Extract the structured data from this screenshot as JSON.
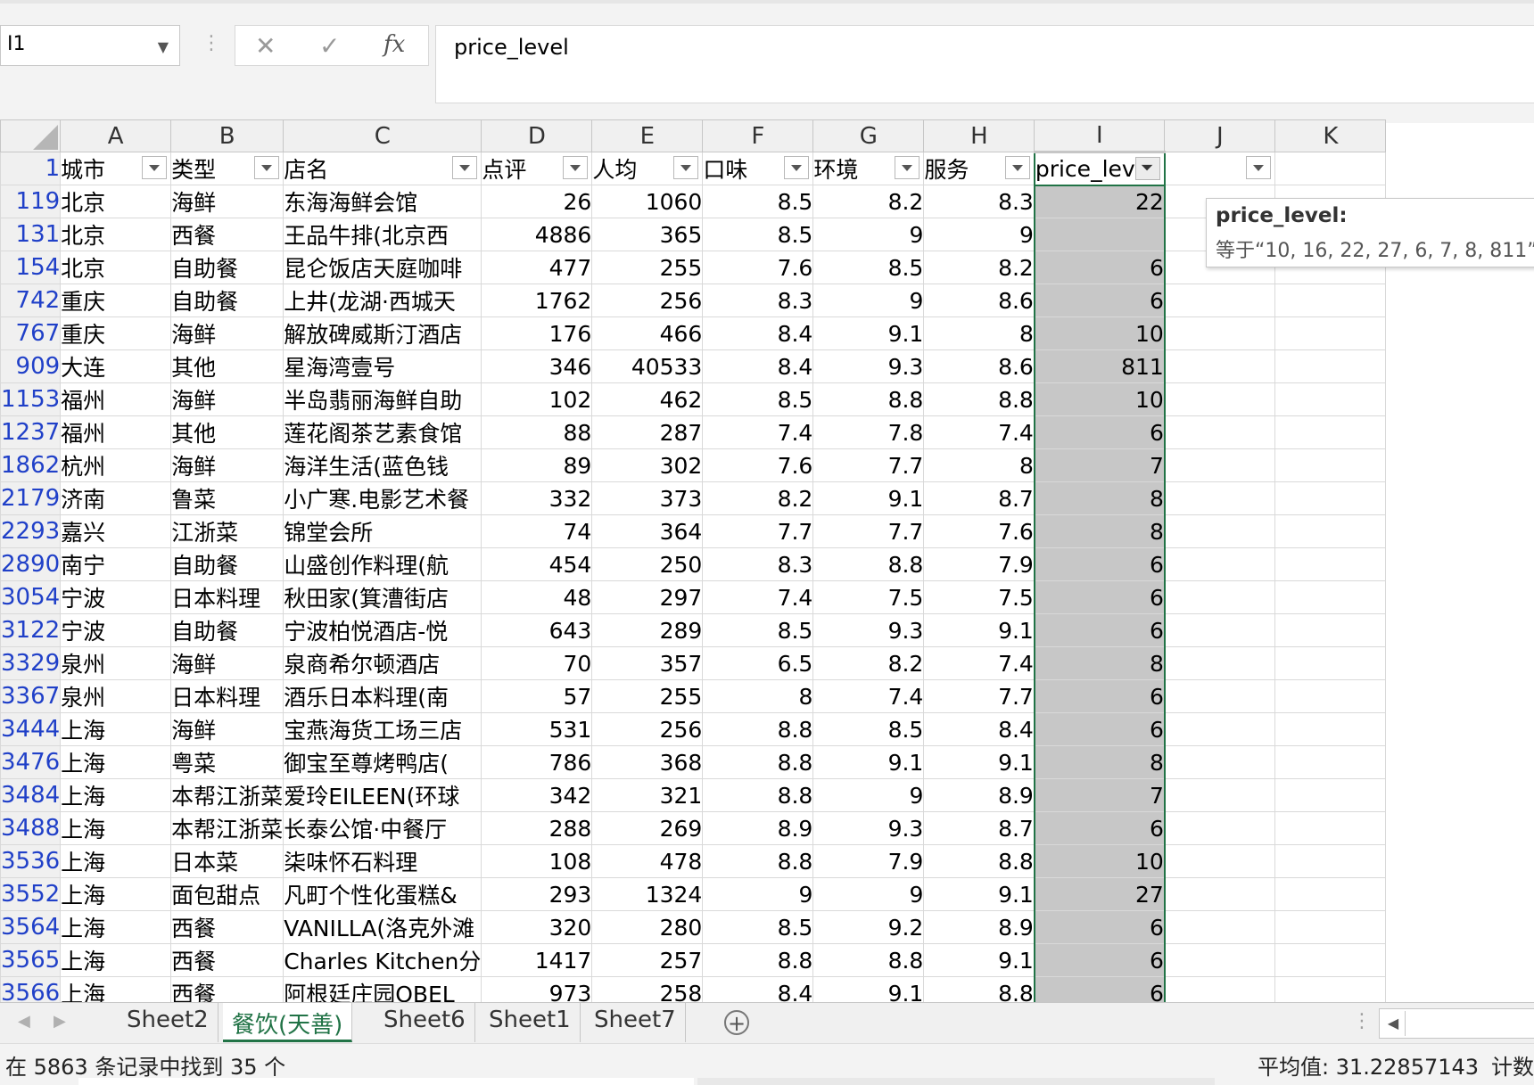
{
  "formula_bar": {
    "name_box": "I1",
    "cancel_icon": "✕",
    "enter_icon": "✓",
    "fx_label": "fx",
    "content": "price_level"
  },
  "columns": [
    "A",
    "B",
    "C",
    "D",
    "E",
    "F",
    "G",
    "H",
    "I",
    "J",
    "K"
  ],
  "selected_column": "I",
  "header_row": {
    "row_number": "1",
    "cells": [
      "城市",
      "类型",
      "店名",
      "点评",
      "人均",
      "口味",
      "环境",
      "服务",
      "price_leve",
      ""
    ]
  },
  "rows": [
    {
      "n": "119",
      "city": "北京",
      "type": "海鲜",
      "name": "东海海鲜会馆",
      "reviews": "26",
      "avg": "1060",
      "taste": "8.5",
      "env": "8.2",
      "service": "8.3",
      "price_level": "22"
    },
    {
      "n": "131",
      "city": "北京",
      "type": "西餐",
      "name": "王品牛排(北京西",
      "reviews": "4886",
      "avg": "365",
      "taste": "8.5",
      "env": "9",
      "service": "9",
      "price_level": ""
    },
    {
      "n": "154",
      "city": "北京",
      "type": "自助餐",
      "name": "昆仑饭店天庭咖啡",
      "reviews": "477",
      "avg": "255",
      "taste": "7.6",
      "env": "8.5",
      "service": "8.2",
      "price_level": "6"
    },
    {
      "n": "742",
      "city": "重庆",
      "type": "自助餐",
      "name": "上井(龙湖·西城天",
      "reviews": "1762",
      "avg": "256",
      "taste": "8.3",
      "env": "9",
      "service": "8.6",
      "price_level": "6"
    },
    {
      "n": "767",
      "city": "重庆",
      "type": "海鲜",
      "name": "解放碑威斯汀酒店",
      "reviews": "176",
      "avg": "466",
      "taste": "8.4",
      "env": "9.1",
      "service": "8",
      "price_level": "10"
    },
    {
      "n": "909",
      "city": "大连",
      "type": "其他",
      "name": "星海湾壹号",
      "reviews": "346",
      "avg": "40533",
      "taste": "8.4",
      "env": "9.3",
      "service": "8.6",
      "price_level": "811"
    },
    {
      "n": "1153",
      "city": "福州",
      "type": "海鲜",
      "name": "半岛翡丽海鲜自助",
      "reviews": "102",
      "avg": "462",
      "taste": "8.5",
      "env": "8.8",
      "service": "8.8",
      "price_level": "10"
    },
    {
      "n": "1237",
      "city": "福州",
      "type": "其他",
      "name": "莲花阁茶艺素食馆",
      "reviews": "88",
      "avg": "287",
      "taste": "7.4",
      "env": "7.8",
      "service": "7.4",
      "price_level": "6"
    },
    {
      "n": "1862",
      "city": "杭州",
      "type": "海鲜",
      "name": "海洋生活(蓝色钱",
      "reviews": "89",
      "avg": "302",
      "taste": "7.6",
      "env": "7.7",
      "service": "8",
      "price_level": "7"
    },
    {
      "n": "2179",
      "city": "济南",
      "type": "鲁菜",
      "name": "小广寒.电影艺术餐",
      "reviews": "332",
      "avg": "373",
      "taste": "8.2",
      "env": "9.1",
      "service": "8.7",
      "price_level": "8"
    },
    {
      "n": "2293",
      "city": "嘉兴",
      "type": "江浙菜",
      "name": "锦堂会所",
      "reviews": "74",
      "avg": "364",
      "taste": "7.7",
      "env": "7.7",
      "service": "7.6",
      "price_level": "8"
    },
    {
      "n": "2890",
      "city": "南宁",
      "type": "自助餐",
      "name": "山盛创作料理(航",
      "reviews": "454",
      "avg": "250",
      "taste": "8.3",
      "env": "8.8",
      "service": "7.9",
      "price_level": "6"
    },
    {
      "n": "3054",
      "city": "宁波",
      "type": "日本料理",
      "name": "秋田家(箕漕街店",
      "reviews": "48",
      "avg": "297",
      "taste": "7.4",
      "env": "7.5",
      "service": "7.5",
      "price_level": "6"
    },
    {
      "n": "3122",
      "city": "宁波",
      "type": "自助餐",
      "name": "宁波柏悦酒店-悦",
      "reviews": "643",
      "avg": "289",
      "taste": "8.5",
      "env": "9.3",
      "service": "9.1",
      "price_level": "6"
    },
    {
      "n": "3329",
      "city": "泉州",
      "type": "海鲜",
      "name": "泉商希尔顿酒店",
      "reviews": "70",
      "avg": "357",
      "taste": "6.5",
      "env": "8.2",
      "service": "7.4",
      "price_level": "8"
    },
    {
      "n": "3367",
      "city": "泉州",
      "type": "日本料理",
      "name": "酒乐日本料理(南",
      "reviews": "57",
      "avg": "255",
      "taste": "8",
      "env": "7.4",
      "service": "7.7",
      "price_level": "6"
    },
    {
      "n": "3444",
      "city": "上海",
      "type": "海鲜",
      "name": "宝燕海货工场三店",
      "reviews": "531",
      "avg": "256",
      "taste": "8.8",
      "env": "8.5",
      "service": "8.4",
      "price_level": "6"
    },
    {
      "n": "3476",
      "city": "上海",
      "type": "粤菜",
      "name": "御宝至尊烤鸭店(",
      "reviews": "786",
      "avg": "368",
      "taste": "8.8",
      "env": "9.1",
      "service": "9.1",
      "price_level": "8"
    },
    {
      "n": "3484",
      "city": "上海",
      "type": "本帮江浙菜",
      "name": "爱玲EILEEN(环球",
      "reviews": "342",
      "avg": "321",
      "taste": "8.8",
      "env": "9",
      "service": "8.9",
      "price_level": "7"
    },
    {
      "n": "3488",
      "city": "上海",
      "type": "本帮江浙菜",
      "name": "长泰公馆·中餐厅",
      "reviews": "288",
      "avg": "269",
      "taste": "8.9",
      "env": "9.3",
      "service": "8.7",
      "price_level": "6"
    },
    {
      "n": "3536",
      "city": "上海",
      "type": "日本菜",
      "name": "柒味怀石料理",
      "reviews": "108",
      "avg": "478",
      "taste": "8.8",
      "env": "7.9",
      "service": "8.8",
      "price_level": "10"
    },
    {
      "n": "3552",
      "city": "上海",
      "type": "面包甜点",
      "name": "凡町个性化蛋糕&",
      "reviews": "293",
      "avg": "1324",
      "taste": "9",
      "env": "9",
      "service": "9.1",
      "price_level": "27"
    },
    {
      "n": "3564",
      "city": "上海",
      "type": "西餐",
      "name": "VANILLA(洛克外滩",
      "reviews": "320",
      "avg": "280",
      "taste": "8.5",
      "env": "9.2",
      "service": "8.9",
      "price_level": "6"
    },
    {
      "n": "3565",
      "city": "上海",
      "type": "西餐",
      "name": "Charles Kitchen分",
      "reviews": "1417",
      "avg": "257",
      "taste": "8.8",
      "env": "8.8",
      "service": "9.1",
      "price_level": "6"
    },
    {
      "n": "3566",
      "city": "上海",
      "type": "西餐",
      "name": "阿根廷庄园OBEL",
      "reviews": "973",
      "avg": "258",
      "taste": "8.4",
      "env": "9.1",
      "service": "8.8",
      "price_level": "6"
    }
  ],
  "tooltip": {
    "title": "price_level:",
    "body": "等于“10, 16, 22, 27, 6, 7, 8, 811”"
  },
  "sheet_tabs": [
    {
      "label": "Sheet2",
      "active": false
    },
    {
      "label": "餐饮(天善)",
      "active": true
    },
    {
      "label": "Sheet6",
      "active": false
    },
    {
      "label": "Sheet1",
      "active": false
    },
    {
      "label": "Sheet7",
      "active": false
    }
  ],
  "status_bar": {
    "filter_message": "在 5863 条记录中找到 35 个",
    "average": "平均值: 31.22857143",
    "count": "计数"
  },
  "colors": {
    "accent_green": "#217346",
    "selected_column_fill": "#c7c7c7",
    "row_number_blue": "#2040c8"
  }
}
